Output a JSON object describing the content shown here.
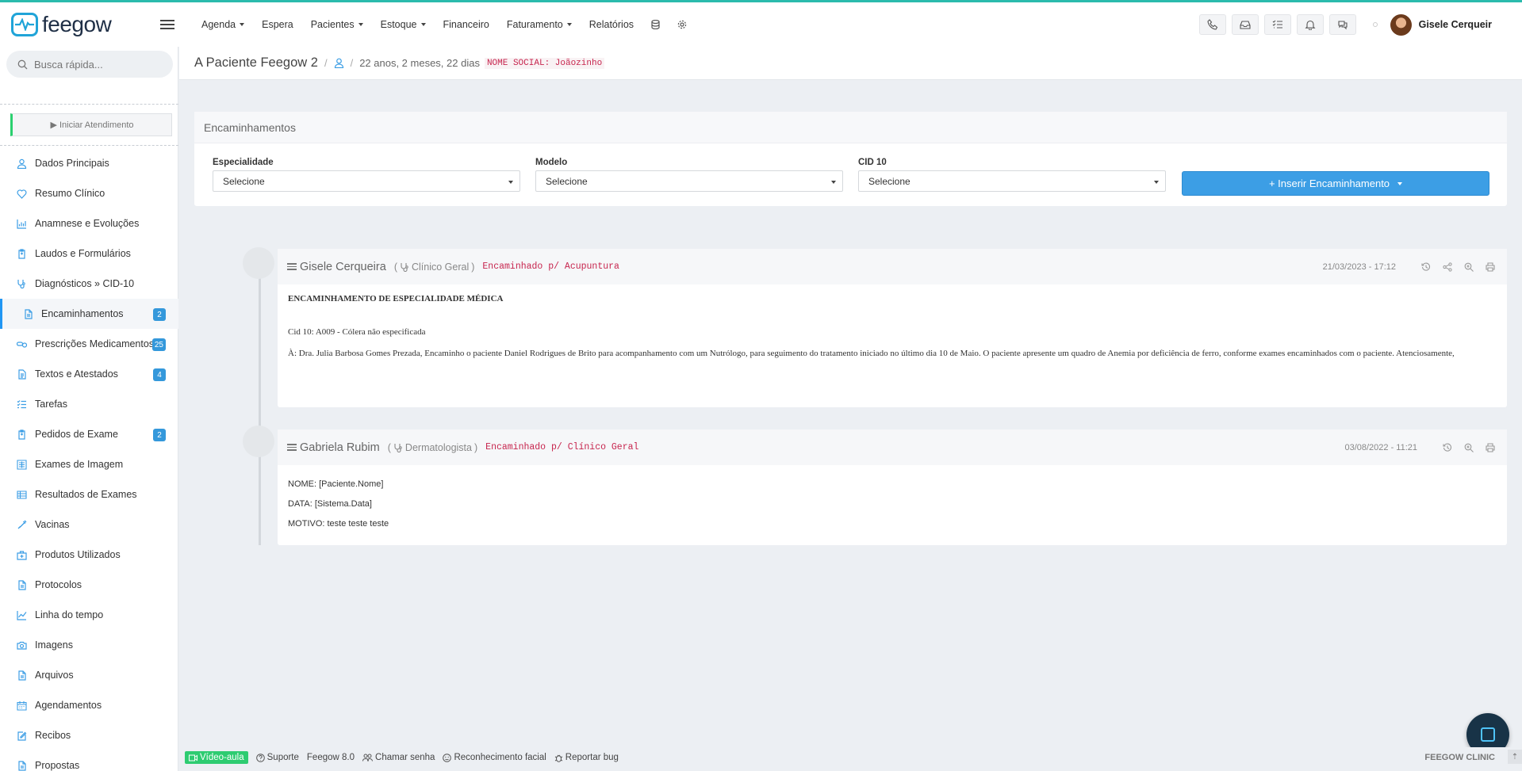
{
  "topbar": {
    "logo_text": "feegow",
    "nav": [
      {
        "label": "Agenda",
        "caret": true
      },
      {
        "label": "Espera",
        "caret": false
      },
      {
        "label": "Pacientes",
        "caret": true
      },
      {
        "label": "Estoque",
        "caret": true
      },
      {
        "label": "Financeiro",
        "caret": false
      },
      {
        "label": "Faturamento",
        "caret": true
      },
      {
        "label": "Relatórios",
        "caret": false
      }
    ],
    "user_name": "Gisele Cerqueir"
  },
  "sidebar": {
    "search_placeholder": "Busca rápida...",
    "start_button": "▶ Iniciar Atendimento",
    "items": [
      {
        "label": "Dados Principais",
        "icon": "user-icon",
        "badge": ""
      },
      {
        "label": "Resumo Clínico",
        "icon": "heart-icon",
        "badge": ""
      },
      {
        "label": "Anamnese e Evoluções",
        "icon": "chart-icon",
        "badge": ""
      },
      {
        "label": "Laudos e Formulários",
        "icon": "clipboard-icon",
        "badge": ""
      },
      {
        "label": "Diagnósticos » CID-10",
        "icon": "stethoscope-icon",
        "badge": ""
      },
      {
        "label": "Encaminhamentos",
        "icon": "file-icon",
        "badge": "2"
      },
      {
        "label": "Prescrições Medicamentos",
        "icon": "pills-icon",
        "badge": "25"
      },
      {
        "label": "Textos e Atestados",
        "icon": "document-icon",
        "badge": "4"
      },
      {
        "label": "Tarefas",
        "icon": "tasks-icon",
        "badge": ""
      },
      {
        "label": "Pedidos de Exame",
        "icon": "clipboard-icon",
        "badge": "2"
      },
      {
        "label": "Exames de Imagem",
        "icon": "xray-icon",
        "badge": ""
      },
      {
        "label": "Resultados de Exames",
        "icon": "table-icon",
        "badge": ""
      },
      {
        "label": "Vacinas",
        "icon": "syringe-icon",
        "badge": ""
      },
      {
        "label": "Produtos Utilizados",
        "icon": "medkit-icon",
        "badge": ""
      },
      {
        "label": "Protocolos",
        "icon": "file-icon",
        "badge": ""
      },
      {
        "label": "Linha do tempo",
        "icon": "line-chart-icon",
        "badge": ""
      },
      {
        "label": "Imagens",
        "icon": "camera-icon",
        "badge": ""
      },
      {
        "label": "Arquivos",
        "icon": "file-icon",
        "badge": ""
      },
      {
        "label": "Agendamentos",
        "icon": "calendar-icon",
        "badge": ""
      },
      {
        "label": "Recibos",
        "icon": "receipt-icon",
        "badge": ""
      },
      {
        "label": "Propostas",
        "icon": "file-icon",
        "badge": ""
      }
    ]
  },
  "header": {
    "patient_name": "A Paciente Feegow 2",
    "age": "22 anos, 2 meses, 22 dias",
    "social_name": "NOME SOCIAL: Joãozinho"
  },
  "panel": {
    "title": "Encaminhamentos",
    "fields": [
      {
        "label": "Especialidade",
        "value": "Selecione"
      },
      {
        "label": "Modelo",
        "value": "Selecione"
      },
      {
        "label": "CID 10",
        "value": "Selecione"
      }
    ],
    "insert_button": "+ Inserir Encaminhamento"
  },
  "cards": [
    {
      "doctor": "Gisele Cerqueira",
      "specialty": "Clínico Geral",
      "tag": "Encaminhado p/ Acupuntura",
      "date": "21/03/2023 - 17:12",
      "title": "ENCAMINHAMENTO DE ESPECIALIDADE MÉDICA",
      "cid": "Cid 10: A009 - Cólera não especificada",
      "text": "À: Dra. Julia Barbosa Gomes   Prezada,  Encaminho o paciente Daniel Rodrigues de Brito para acompanhamento com um Nutrólogo, para seguimento do tratamento iniciado no último dia 10 de Maio. O paciente apresente um quadro de Anemia por deficiência de ferro, conforme exames encaminhados com o paciente.    Atenciosamente,"
    },
    {
      "doctor": "Gabriela Rubim",
      "specialty": "Dermatologista",
      "tag": "Encaminhado p/ Clínico Geral",
      "date": "03/08/2022 - 11:21",
      "lines": [
        "NOME: [Paciente.Nome]",
        "DATA: [Sistema.Data]",
        "MOTIVO:  teste teste teste"
      ]
    }
  ],
  "footer": {
    "video": "Vídeo-aula",
    "support": "Suporte",
    "version": "Feegow 8.0",
    "call": "Chamar senha",
    "face": "Reconhecimento facial",
    "bug": "Reportar bug",
    "brand": "FEEGOW CLINIC"
  },
  "colors": {
    "accent": "#3c9ee5",
    "teal": "#2bbbad",
    "green": "#2ecc71",
    "tag": "#c7254e"
  }
}
